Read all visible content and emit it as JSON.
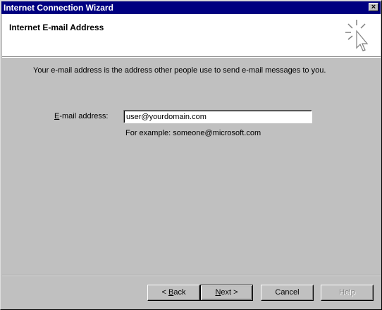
{
  "window": {
    "title": "Internet Connection Wizard",
    "close_glyph": "×"
  },
  "header": {
    "title": "Internet E-mail Address",
    "icon": "wizard-cursor-icon"
  },
  "main": {
    "description": "Your e-mail address is the address other people use to send e-mail messages to you.",
    "email_label_accel": "E",
    "email_label_rest": "-mail address:",
    "email_value": "user@yourdomain.com",
    "example": "For example: someone@microsoft.com"
  },
  "buttons": {
    "back_prefix": "< ",
    "back_accel": "B",
    "back_rest": "ack",
    "next_accel": "N",
    "next_rest": "ext >",
    "cancel": "Cancel",
    "help": "Help"
  },
  "colors": {
    "titlebar": "#000080",
    "face": "#c0c0c0",
    "header_bg": "#ffffff"
  }
}
